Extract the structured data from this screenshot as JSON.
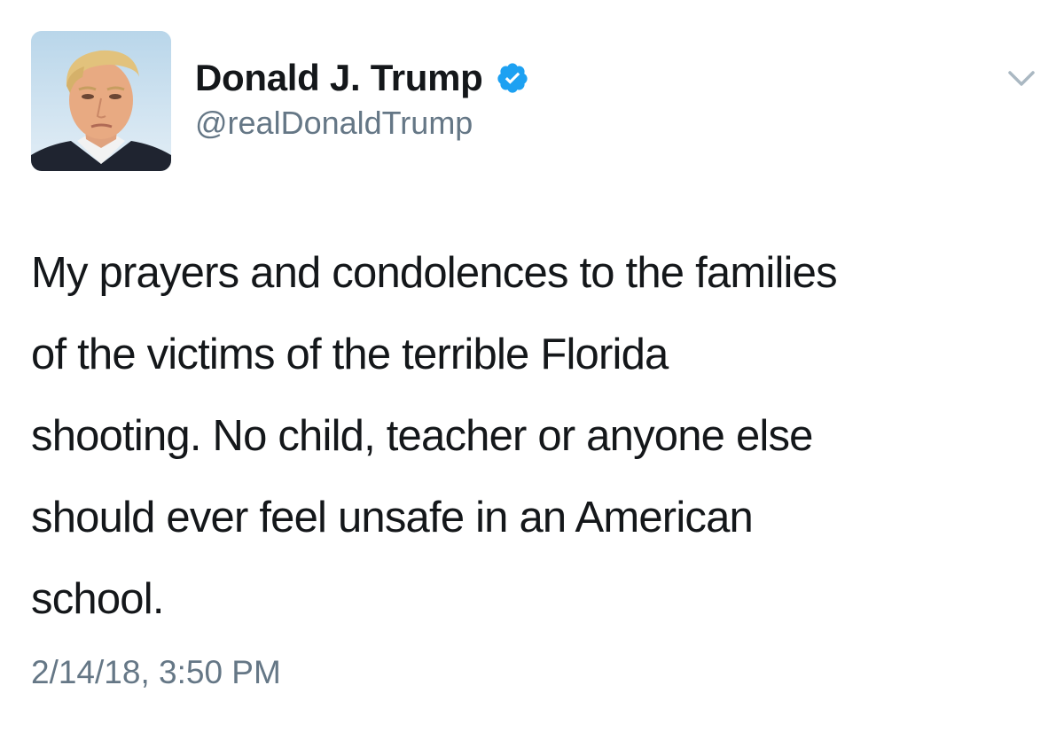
{
  "tweet": {
    "author": {
      "display_name": "Donald J. Trump",
      "handle": "@realDonaldTrump",
      "verified": true,
      "avatar_icon": "profile-photo"
    },
    "lines": [
      "My prayers and condolences to the families",
      "of the victims of the terrible Florida",
      "shooting. No child, teacher or anyone else",
      "should ever feel unsafe in an American",
      "school."
    ],
    "timestamp": "2/14/18, 3:50 PM",
    "menu_icon": "chevron-down-icon"
  },
  "colors": {
    "text": "#14171a",
    "secondary": "#657786",
    "verified_badge": "#1da1f2",
    "caret": "#aab8c2"
  }
}
